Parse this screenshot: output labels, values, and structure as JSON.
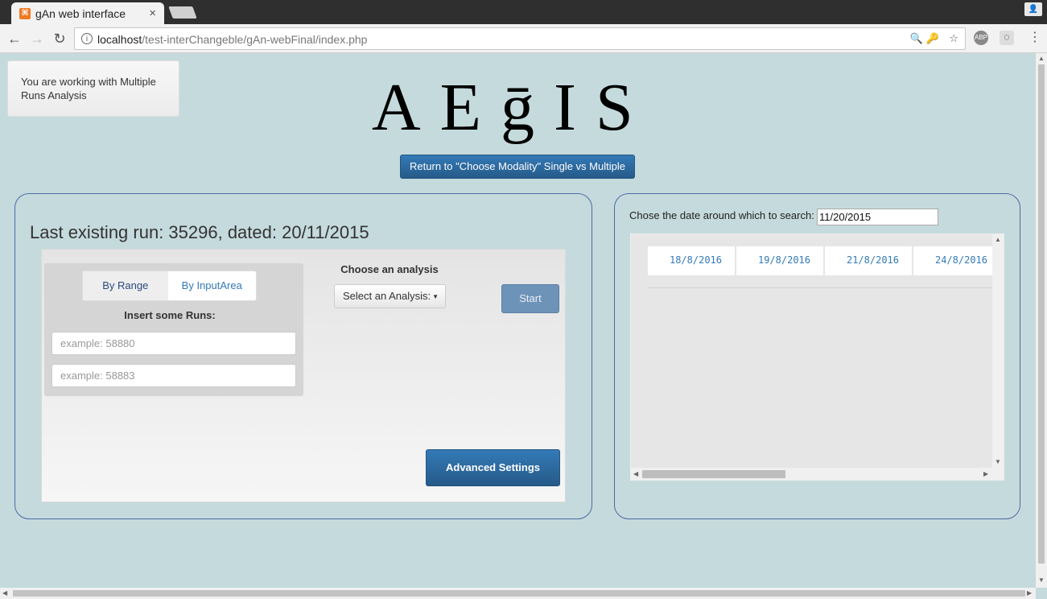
{
  "browser": {
    "tab_title": "gAn web interface",
    "tab_close": "×",
    "url_host": "localhost",
    "url_path": "/test-interChangeble/gAn-webFinal/index.php",
    "ext_abp": "ABP"
  },
  "page": {
    "mode_text": "You are working with Multiple Runs Analysis",
    "logo": "AEḡIS",
    "return_button": "Return to \"Choose Modality\" Single vs Multiple"
  },
  "runs_panel": {
    "last_run": "Last existing run: 35296, dated: 20/11/2015",
    "tabs": [
      "By Range",
      "By InputArea"
    ],
    "insert_label": "Insert some Runs:",
    "input1_placeholder": "example: 58880",
    "input2_placeholder": "example: 58883",
    "choose_label": "Choose an analysis",
    "select_value": "Select an Analysis:",
    "start_button": "Start",
    "advanced_button": "Advanced Settings"
  },
  "date_panel": {
    "label": "Chose the date around which to search:",
    "date_value": "11/20/2015",
    "dates": [
      "18/8/2016",
      "19/8/2016",
      "21/8/2016",
      "24/8/2016"
    ]
  },
  "colors": {
    "page_bg": "#c5dadc",
    "primary_button": "#337ab7",
    "panel_border": "#4c6aa8"
  }
}
